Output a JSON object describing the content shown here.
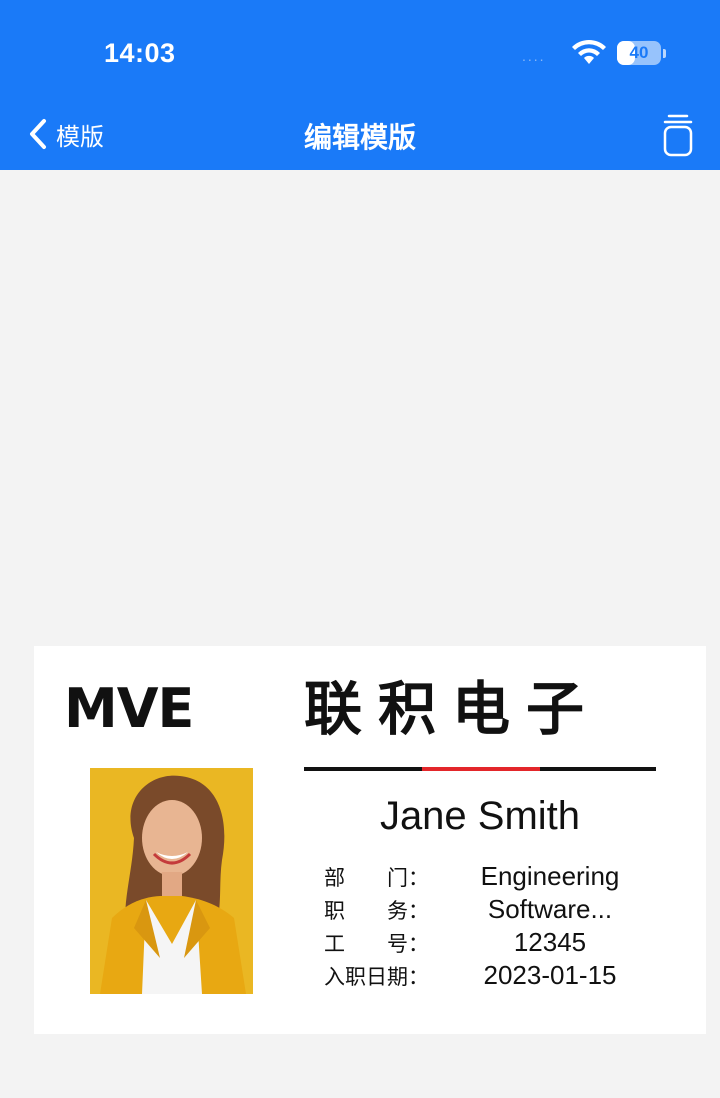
{
  "status_bar": {
    "time": "14:03",
    "signal": "....",
    "battery_level": 40,
    "battery_text": "40"
  },
  "nav": {
    "back_label": "模版",
    "title": "编辑模版",
    "back_icon": "chevron-left-icon",
    "action_icon": "trash-icon"
  },
  "badge": {
    "logo_text": "MVE",
    "company_name": "联积电子",
    "name": "Jane Smith",
    "fields": [
      {
        "label": "部　　门：",
        "value": "Engineering"
      },
      {
        "label": "职　　务：",
        "value": "Software..."
      },
      {
        "label": "工　　号：",
        "value": "12345"
      },
      {
        "label": "入职日期：",
        "value": "2023-01-15"
      }
    ]
  },
  "colors": {
    "header": "#1a7af8",
    "accent_red": "#e3262a",
    "background": "#f3f3f3"
  }
}
